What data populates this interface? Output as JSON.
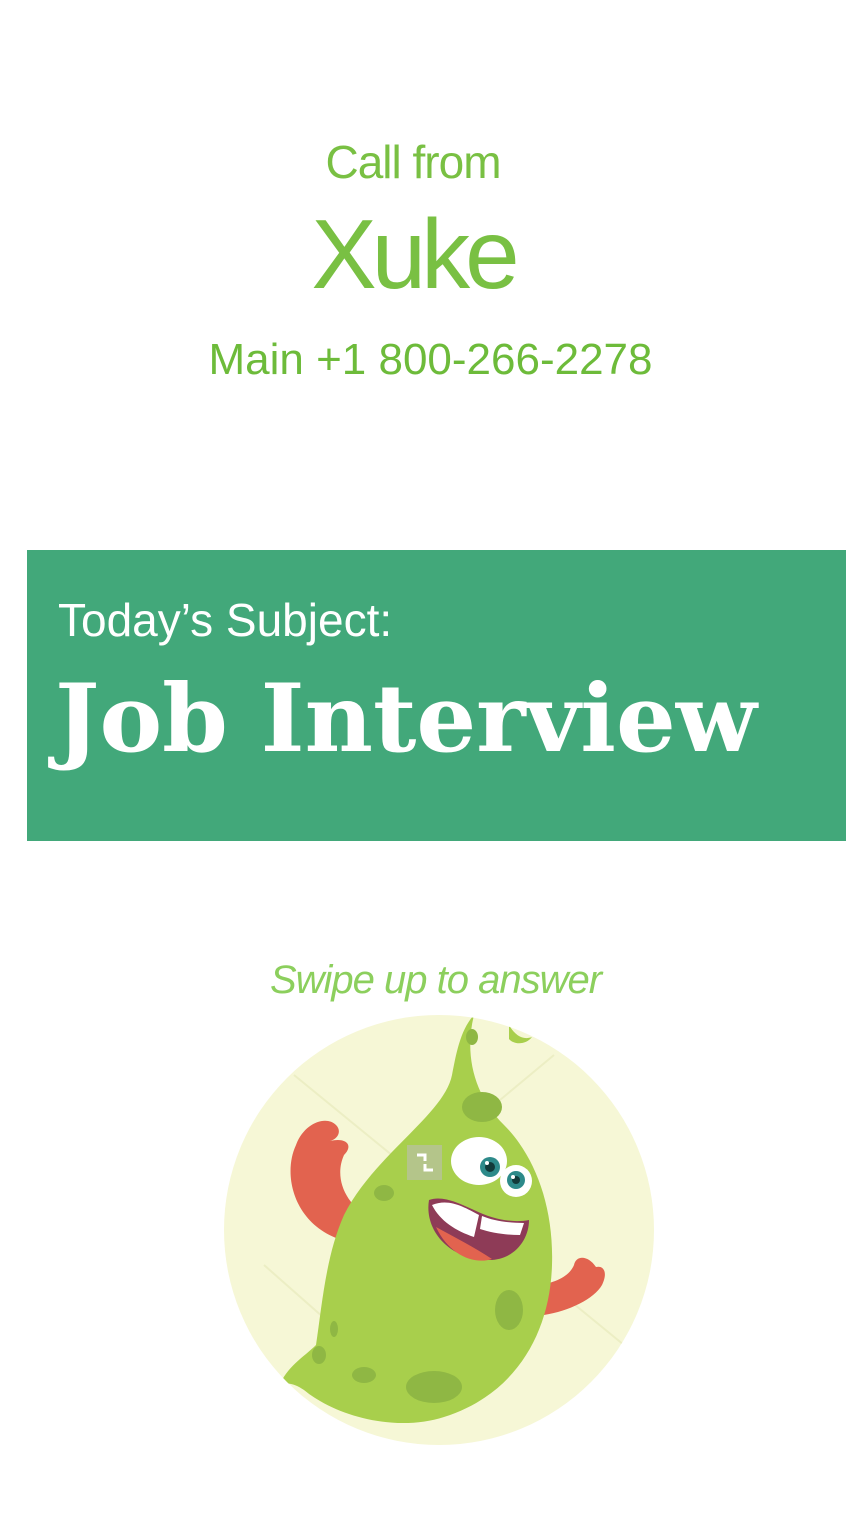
{
  "call": {
    "label": "Call from",
    "caller_name": "Xuke",
    "caller_number": "Main +1 800-266-2278"
  },
  "banner": {
    "label": "Today’s Subject:",
    "title": "Job Interview",
    "background_color": "#42a87a"
  },
  "answer": {
    "hint": "Swipe up to answer",
    "avatar_icon": "green-monster-avatar-icon"
  },
  "colors": {
    "accent_green": "#79c043",
    "banner_green": "#42a87a",
    "avatar_background": "#f6f7d6"
  }
}
